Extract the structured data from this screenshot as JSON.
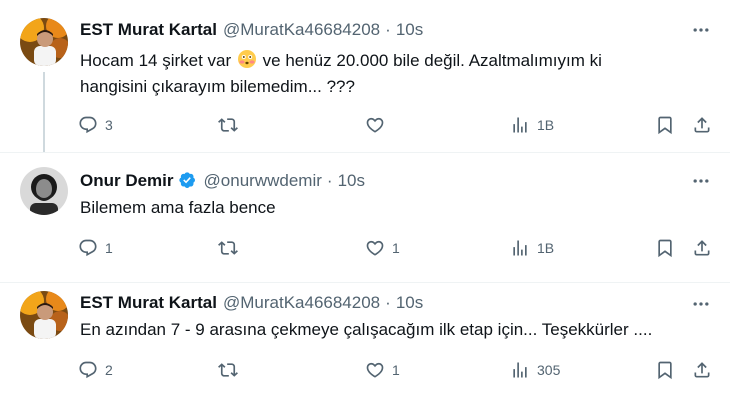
{
  "tweets": [
    {
      "author": "EST Murat Kartal",
      "handle": "@MuratKa46684208",
      "time": "10s",
      "verified": false,
      "text_line1_before_emoji": "Hocam 14 şirket var",
      "emoji": "flushed-face-emoji",
      "text_line1_after_emoji": "ve henüz 20.000 bile değil. Azaltmalımıyım ki",
      "text_line2": "hangisini çıkarayım bilemedim... ???",
      "replies": "3",
      "retweets": "",
      "likes": "",
      "views": "1B"
    },
    {
      "author": "Onur Demir",
      "handle": "@onurwwdemir",
      "time": "10s",
      "verified": true,
      "text_line1": "Bilemem ama fazla bence",
      "replies": "1",
      "retweets": "",
      "likes": "1",
      "views": "1B"
    },
    {
      "author": "EST Murat Kartal",
      "handle": "@MuratKa46684208",
      "time": "10s",
      "verified": false,
      "text_line1": "En azından 7 - 9 arasına çekmeye çalışacağım ilk etap için... Teşekkürler ....",
      "replies": "2",
      "retweets": "",
      "likes": "1",
      "views": "305"
    }
  ],
  "separator": "·",
  "colors": {
    "text_primary": "#0f1419",
    "text_secondary": "#536471",
    "verified_blue": "#1d9bf0",
    "thread_line": "#cfd9de",
    "divider": "#eff3f4"
  },
  "icons": {
    "reply": "reply-icon",
    "retweet": "retweet-icon",
    "like": "heart-icon",
    "views": "views-icon",
    "bookmark": "bookmark-icon",
    "share": "share-icon",
    "more": "more-icon",
    "verified": "verified-badge-icon"
  }
}
